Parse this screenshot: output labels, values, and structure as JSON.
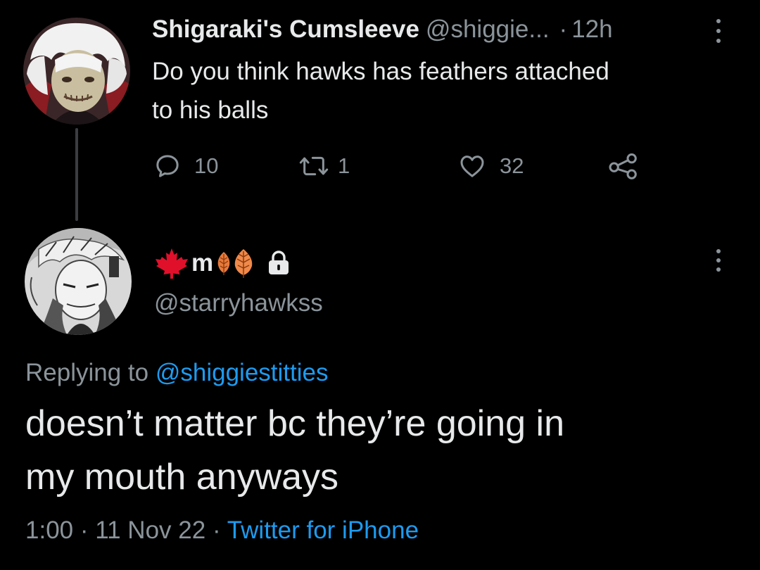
{
  "tweet": {
    "display_name": "Shigaraki's Cumsleeve",
    "handle": "@shiggie...",
    "separator": "·",
    "time": "12h",
    "text_line1": "Do you think hawks has feathers attached",
    "text_line2": "to his balls",
    "actions": {
      "reply_count": "10",
      "retweet_count": "1",
      "like_count": "32"
    }
  },
  "reply": {
    "display_name": "m",
    "handle": "@starryhawkss",
    "replying_prefix": "Replying to",
    "replying_to": "@shiggiestitties",
    "text_line1": "doesn’t matter bc they’re going in",
    "text_line2": "my mouth anyways",
    "time": "1:00",
    "separator1": "·",
    "date": "11 Nov 22",
    "separator2": "·",
    "source": "Twitter for iPhone"
  },
  "icons": {
    "flag": "maple-leaf-icon",
    "leaves": "autumn-leaf-icon",
    "protected": "lock-icon",
    "reply": "reply-icon",
    "retweet": "retweet-icon",
    "like": "heart-icon",
    "share": "share-icon",
    "more": "more-icon"
  },
  "colors": {
    "background": "#000000",
    "text": "#e7e9ea",
    "secondary": "#8b949a",
    "link": "#1d9bf0",
    "maple": "#e0102b",
    "leaf": "#e87a3a"
  }
}
